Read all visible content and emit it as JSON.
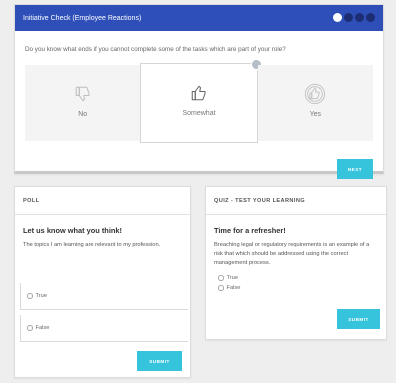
{
  "check": {
    "title": "Initiative Check (Employee Reactions)",
    "question": "Do you know what ends if you cannot complete some of the tasks which are part of your role?",
    "options": [
      {
        "label": "No",
        "icon": "thumbs-down-icon"
      },
      {
        "label": "Somewhat",
        "icon": "thumbs-sideways-icon"
      },
      {
        "label": "Yes",
        "icon": "thumbs-up-seal-icon"
      }
    ],
    "next_label": "NEXT"
  },
  "poll": {
    "header": "POLL",
    "title": "Let us know what you think!",
    "text": "The topics I am learning are relevant to my profession.",
    "options": [
      "True",
      "False"
    ],
    "submit_label": "SUBMIT"
  },
  "quiz": {
    "header": "QUIZ - TEST YOUR LEARNING",
    "title": "Time for a refresher!",
    "text": "Breaching legal or regulatory requirements is an example of a risk that which should be addressed using the correct management process.",
    "options": [
      "True",
      "False"
    ],
    "submit_label": "SUBMIT"
  },
  "colors": {
    "header_blue": "#2e4fb8",
    "button_cyan": "#35c4dc",
    "background": "#eeeeee"
  }
}
